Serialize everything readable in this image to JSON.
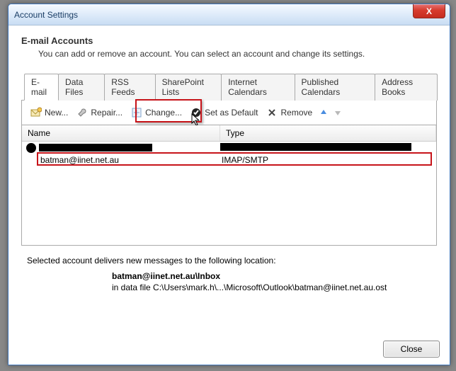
{
  "window": {
    "title": "Account Settings"
  },
  "section": {
    "title": "E-mail Accounts",
    "desc": "You can add or remove an account. You can select an account and change its settings."
  },
  "tabs": {
    "items": [
      {
        "label": "E-mail"
      },
      {
        "label": "Data Files"
      },
      {
        "label": "RSS Feeds"
      },
      {
        "label": "SharePoint Lists"
      },
      {
        "label": "Internet Calendars"
      },
      {
        "label": "Published Calendars"
      },
      {
        "label": "Address Books"
      }
    ],
    "active_index": 0
  },
  "toolbar": {
    "new_label": "New...",
    "repair_label": "Repair...",
    "change_label": "Change...",
    "default_label": "Set as Default",
    "remove_label": "Remove"
  },
  "list": {
    "headers": {
      "name": "Name",
      "type": "Type"
    },
    "rows": [
      {
        "name_redacted": true,
        "type_redacted": true,
        "default": true
      },
      {
        "name": "batman@iinet.net.au",
        "type": "IMAP/SMTP",
        "default": false
      }
    ]
  },
  "delivery": {
    "heading": "Selected account delivers new messages to the following location:",
    "location_main": "batman@iinet.net.au\\Inbox",
    "location_sub": "in data file C:\\Users\\mark.h\\...\\Microsoft\\Outlook\\batman@iinet.net.au.ost"
  },
  "footer": {
    "close_label": "Close"
  },
  "icons": {
    "close_x": "X",
    "check": "✓"
  },
  "colors": {
    "highlight": "#c7141a"
  }
}
